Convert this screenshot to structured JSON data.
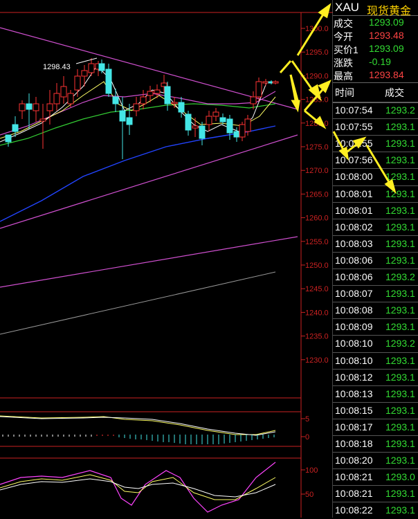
{
  "quote": {
    "symbol": "XAU",
    "name": "现货黄金",
    "rows": [
      {
        "label": "成交",
        "value": "1293.09",
        "color": "#33dd33"
      },
      {
        "label": "今开",
        "value": "1293.48",
        "color": "#ff4444"
      },
      {
        "label": "买价1",
        "value": "1293.09",
        "color": "#33dd33"
      },
      {
        "label": "涨跌",
        "value": "-0.19",
        "color": "#33dd33"
      },
      {
        "label": "最高",
        "value": "1293.84",
        "color": "#ff4444"
      }
    ]
  },
  "ticks": {
    "header_time": "时间",
    "header_price": "成交",
    "rows": [
      {
        "time": "10:07:54",
        "price": "1293.2"
      },
      {
        "time": "10:07:55",
        "price": "1293.1"
      },
      {
        "time": "10:07:55",
        "price": "1293.1"
      },
      {
        "time": "10:07:56",
        "price": "1293.1"
      },
      {
        "time": "10:08:00",
        "price": "1293.1"
      },
      {
        "time": "10:08:01",
        "price": "1293.1"
      },
      {
        "time": "10:08:01",
        "price": "1293.1"
      },
      {
        "time": "10:08:02",
        "price": "1293.1"
      },
      {
        "time": "10:08:03",
        "price": "1293.1"
      },
      {
        "time": "10:08:06",
        "price": "1293.1"
      },
      {
        "time": "10:08:06",
        "price": "1293.2"
      },
      {
        "time": "10:08:07",
        "price": "1293.1"
      },
      {
        "time": "10:08:08",
        "price": "1293.1"
      },
      {
        "time": "10:08:09",
        "price": "1293.1"
      },
      {
        "time": "10:08:10",
        "price": "1293.2"
      },
      {
        "time": "10:08:10",
        "price": "1293.1"
      },
      {
        "time": "10:08:12",
        "price": "1293.1"
      },
      {
        "time": "10:08:13",
        "price": "1293.1"
      },
      {
        "time": "10:08:15",
        "price": "1293.1"
      },
      {
        "time": "10:08:17",
        "price": "1293.1"
      },
      {
        "time": "10:08:18",
        "price": "1293.1"
      },
      {
        "time": "10:08:20",
        "price": "1293.1"
      },
      {
        "time": "10:08:21",
        "price": "1293.0"
      },
      {
        "time": "10:08:21",
        "price": "1293.1"
      },
      {
        "time": "10:08:22",
        "price": "1293.1"
      }
    ]
  },
  "main_chart": {
    "price_axis": [
      "1300.0",
      "1295.0",
      "1290.0",
      "1285.0",
      "1280.0",
      "1275.0",
      "1270.0",
      "1265.0",
      "1260.0",
      "1255.0",
      "1250.0",
      "1245.0",
      "1240.0",
      "1235.0",
      "1230.0"
    ],
    "high_label": "1298.43"
  },
  "macd_axis": [
    "5",
    "0"
  ],
  "kdj_axis": [
    "100",
    "50"
  ],
  "colors": {
    "up": "#ff3333",
    "down": "#44e6e6",
    "axis": "#cc2222",
    "green": "#33dd33",
    "red": "#ff4444"
  }
}
